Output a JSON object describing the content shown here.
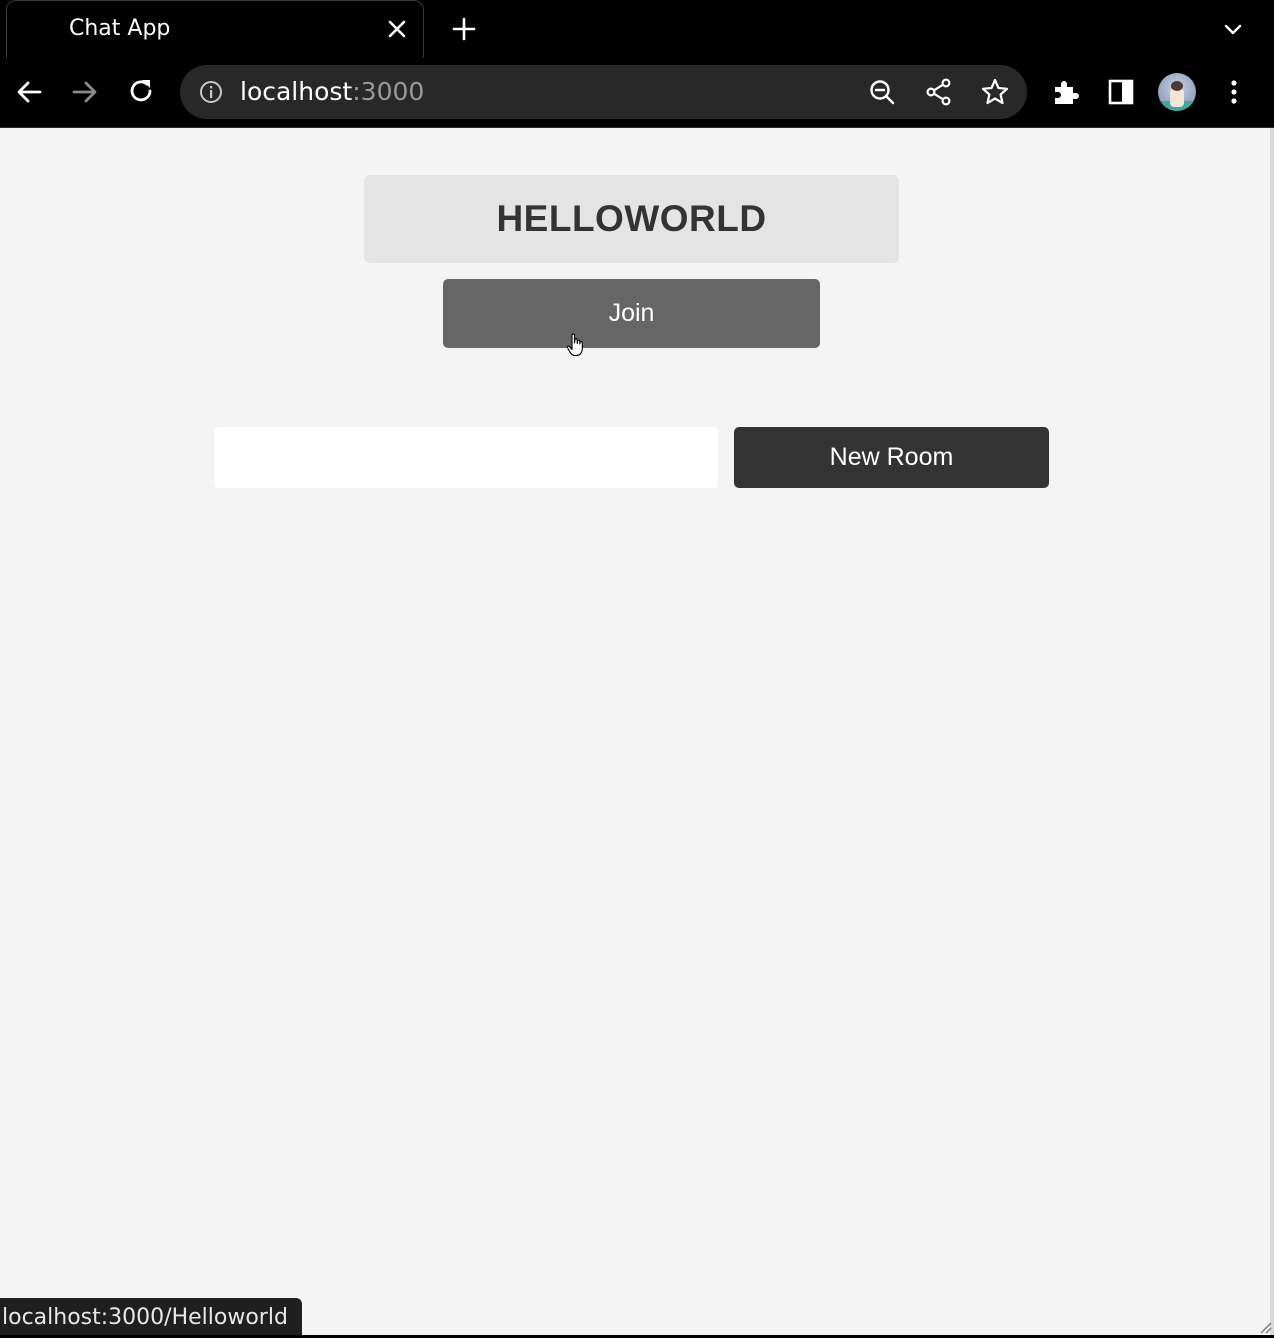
{
  "browser": {
    "tab": {
      "title": "Chat App"
    },
    "address": {
      "host": "localhost",
      "port": ":3000"
    },
    "status_url": "localhost:3000/Helloworld"
  },
  "icons": {
    "tab_close": "close-icon",
    "new_tab": "plus-icon",
    "tab_search": "chevron-down-icon",
    "back": "back-arrow-icon",
    "forward": "forward-arrow-icon",
    "reload": "reload-icon",
    "site_info": "info-icon",
    "zoom": "zoom-out-icon",
    "share": "share-icon",
    "bookmark": "star-icon",
    "extensions": "puzzle-icon",
    "side_panel": "side-panel-icon",
    "menu": "kebab-menu-icon"
  },
  "app": {
    "room_name": "HELLOWORLD",
    "join_label": "Join",
    "new_room_input": {
      "value": "",
      "placeholder": ""
    },
    "new_room_label": "New Room"
  },
  "colors": {
    "page_bg": "#f4f4f4",
    "room_card_bg": "#e4e4e4",
    "join_bg": "#666666",
    "new_room_bg": "#333333",
    "chrome_bg": "#000000"
  }
}
